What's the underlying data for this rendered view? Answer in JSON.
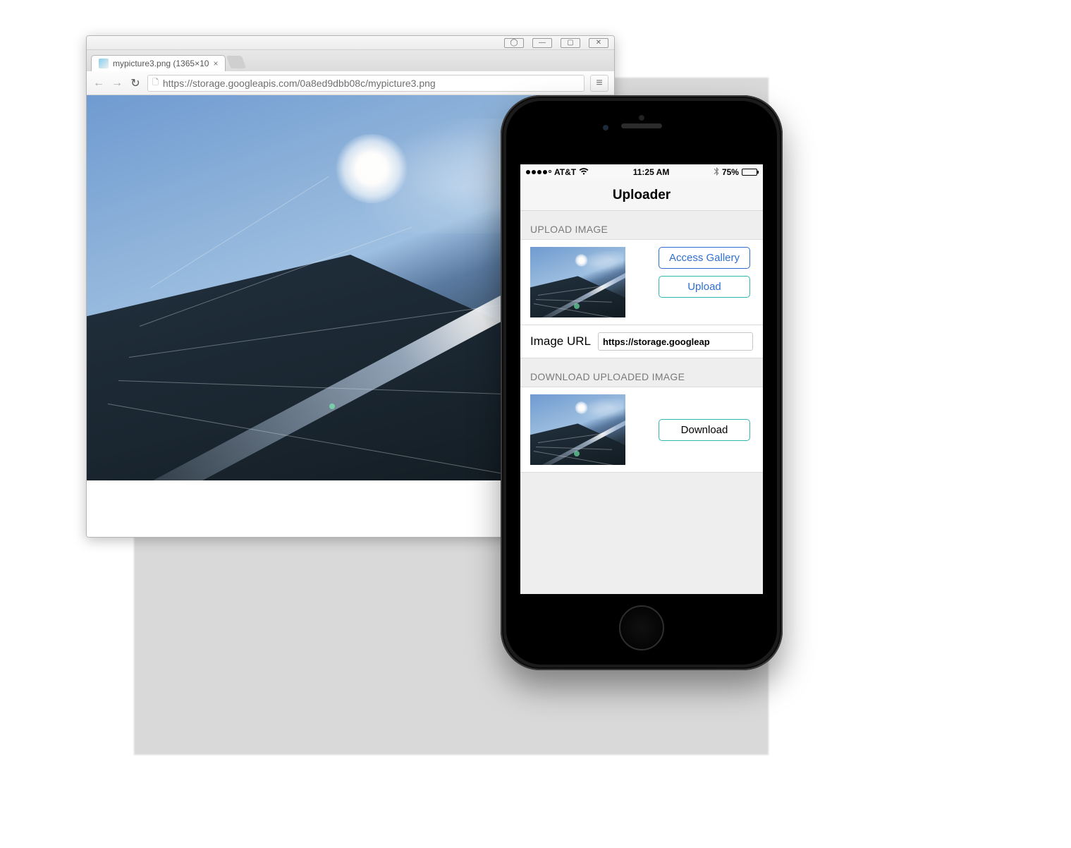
{
  "browser": {
    "tab_title": "mypicture3.png (1365×10",
    "url": "https://storage.googleapis.com/0a8ed9dbb08c/mypicture3.png",
    "window_buttons": {
      "user": "👤",
      "min": "—",
      "max": "▢",
      "close": "✕"
    }
  },
  "phone": {
    "status": {
      "carrier": "AT&T",
      "time": "11:25 AM",
      "battery_pct": "75%"
    },
    "nav_title": "Uploader",
    "sections": {
      "upload_header": "UPLOAD IMAGE",
      "download_header": "DOWNLOAD UPLOADED IMAGE"
    },
    "buttons": {
      "access_gallery": "Access Gallery",
      "upload": "Upload",
      "download": "Download"
    },
    "url_row": {
      "label": "Image URL",
      "value": "https://storage.googleap"
    }
  }
}
